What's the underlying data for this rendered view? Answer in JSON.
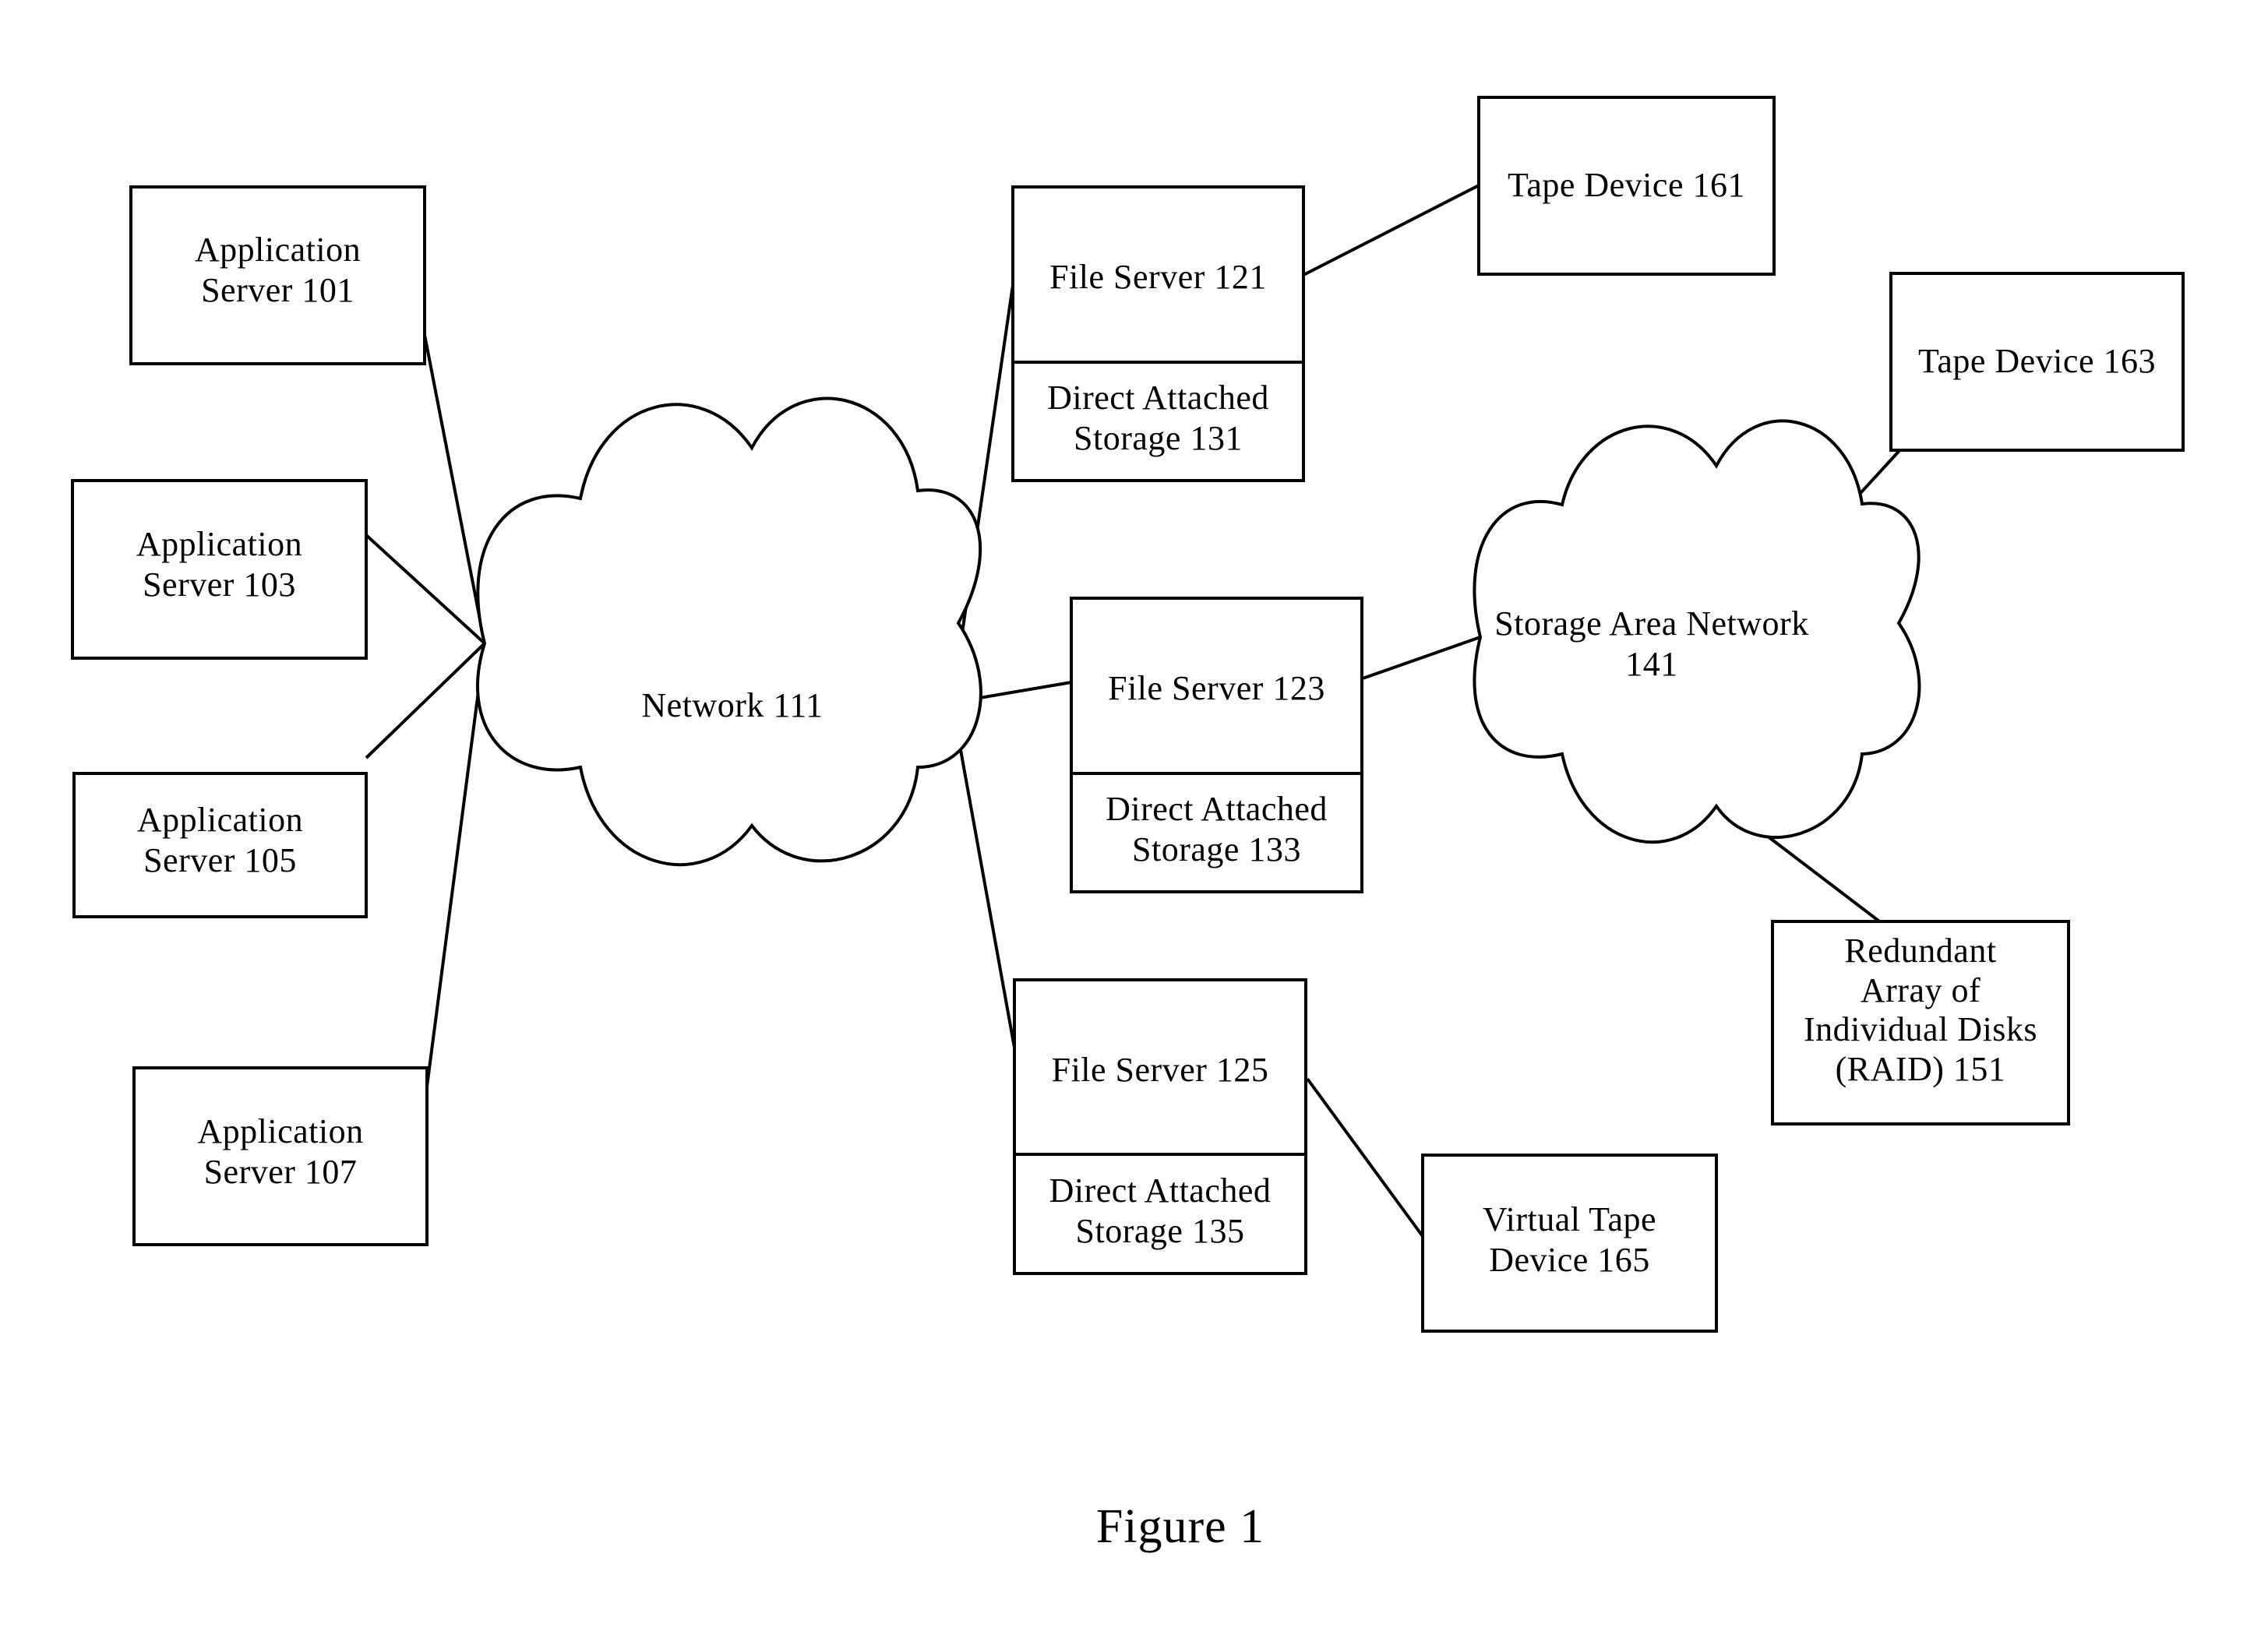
{
  "figure": {
    "caption": "Figure 1"
  },
  "nodes": {
    "application_server_101": {
      "label": "Application\nServer 101",
      "ref": "101",
      "shape": "rect"
    },
    "application_server_103": {
      "label": "Application\nServer 103",
      "ref": "103",
      "shape": "rect"
    },
    "application_server_105": {
      "label": "Application\nServer 105",
      "ref": "105",
      "shape": "rect"
    },
    "application_server_107": {
      "label": "Application\nServer 107",
      "ref": "107",
      "shape": "rect"
    },
    "network_111": {
      "label": "Network 111",
      "ref": "111",
      "shape": "cloud"
    },
    "file_server_121": {
      "label": "File Server 121",
      "ref": "121",
      "shape": "rect"
    },
    "direct_attached_storage_131": {
      "label": "Direct Attached\nStorage 131",
      "ref": "131",
      "shape": "rect"
    },
    "file_server_123": {
      "label": "File Server 123",
      "ref": "123",
      "shape": "rect"
    },
    "direct_attached_storage_133": {
      "label": "Direct Attached\nStorage 133",
      "ref": "133",
      "shape": "rect"
    },
    "file_server_125": {
      "label": "File Server 125",
      "ref": "125",
      "shape": "rect"
    },
    "direct_attached_storage_135": {
      "label": "Direct Attached\nStorage 135",
      "ref": "135",
      "shape": "rect"
    },
    "tape_device_161": {
      "label": "Tape Device 161",
      "ref": "161",
      "shape": "rect"
    },
    "tape_device_163": {
      "label": "Tape Device 163",
      "ref": "163",
      "shape": "rect"
    },
    "virtual_tape_device_165": {
      "label": "Virtual Tape\nDevice 165",
      "ref": "165",
      "shape": "rect"
    },
    "storage_area_network_141": {
      "label": "Storage Area Network 141",
      "ref": "141",
      "shape": "cloud"
    },
    "raid_151": {
      "label": "Redundant\nArray of\nIndividual Disks\n(RAID) 151",
      "ref": "151",
      "shape": "rect"
    }
  },
  "colors": {
    "stroke": "#000000",
    "fill": "#ffffff",
    "text": "#000000"
  }
}
